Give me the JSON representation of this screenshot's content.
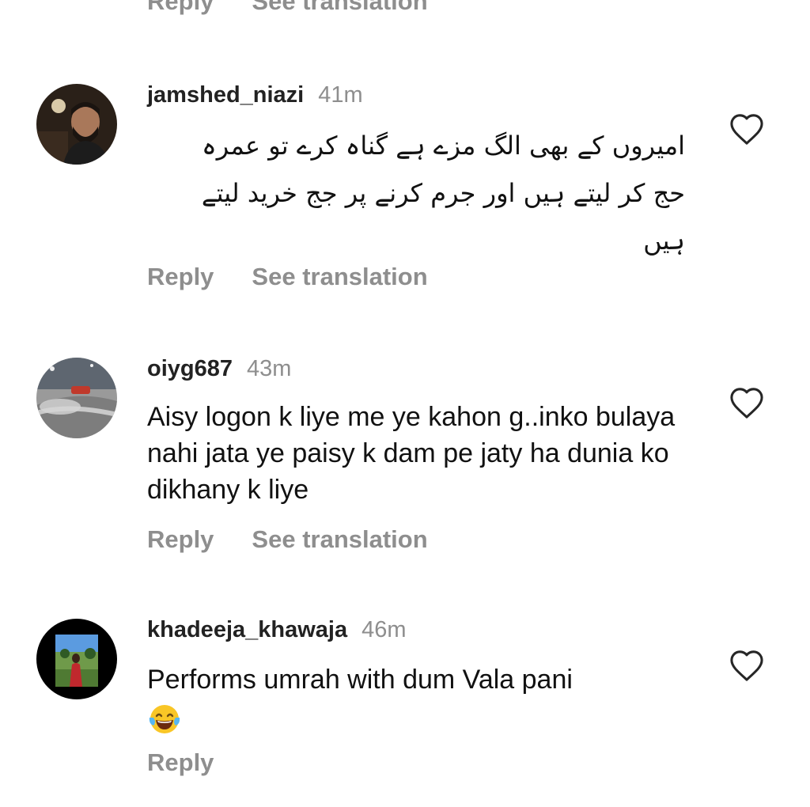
{
  "top_actions": {
    "reply_label": "Reply",
    "translate_label": "See translation"
  },
  "comments": [
    {
      "username": "jamshed_niazi",
      "time": "41m",
      "text_lines": [
        "امیروں کے بھی الگ مزے ہے گناہ کرے تو عمرہ",
        "حج کر لیتے ہیں اور جرم کرنے پر جج خرید لیتے",
        "ہیں"
      ],
      "reply_label": "Reply",
      "translate_label": "See translation",
      "avatar_icon": "man-portrait-avatar"
    },
    {
      "username": "oiyg687",
      "time": "43m",
      "text": "Aisy logon k liye me ye kahon g..inko bulaya nahi jata ye paisy k dam pe jaty ha dunia ko dikhany k liye",
      "reply_label": "Reply",
      "translate_label": "See translation",
      "avatar_icon": "car-road-avatar"
    },
    {
      "username": "khadeeja_khawaja",
      "time": "46m",
      "text": "Performs umrah with dum Vala pani",
      "emoji": "😂",
      "emoji_icon": "tears-of-joy-emoji",
      "reply_label": "Reply",
      "avatar_icon": "woman-in-park-avatar"
    }
  ],
  "icons": {
    "like": "heart-outline-icon"
  },
  "colors": {
    "secondary_text": "#8e8e8e",
    "primary_text": "#111111",
    "background": "#ffffff"
  }
}
